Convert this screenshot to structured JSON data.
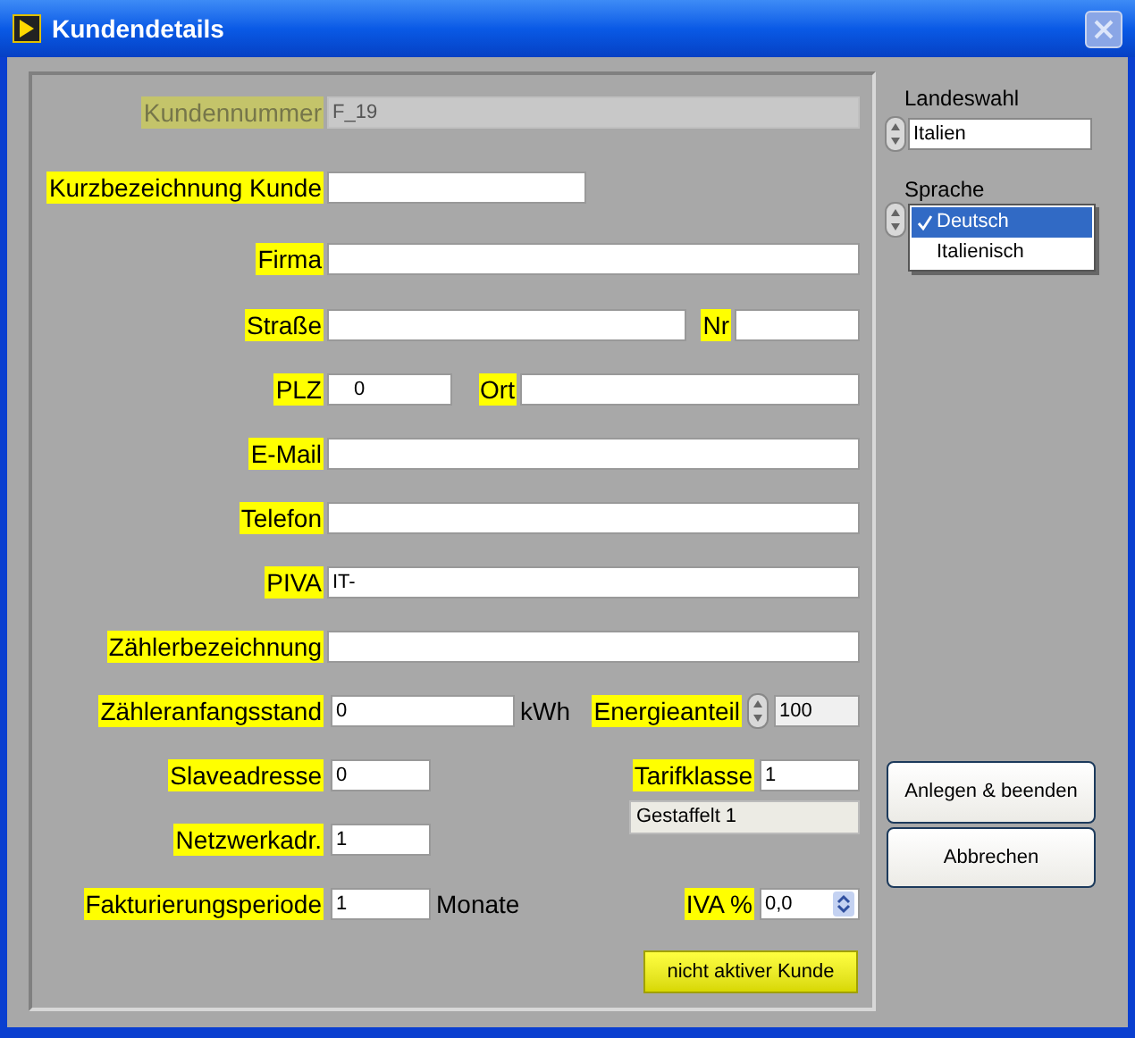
{
  "window": {
    "title": "Kundendetails"
  },
  "fields": [
    {
      "label": "Kundennummer",
      "value": "F_19",
      "kind": "text",
      "disabled": true
    },
    {
      "label": "Kurzbezeichnung Kunde",
      "kind": "text",
      "disabled": false
    },
    {
      "label": "Firma",
      "kind": "text",
      "disabled": false
    },
    {
      "label": "Straße",
      "kind": "text",
      "disabled": false
    },
    {
      "label": "Nr",
      "kind": "text",
      "disabled": false
    },
    {
      "label": "PLZ",
      "value": "0",
      "kind": "text",
      "disabled": false
    },
    {
      "label": "Ort",
      "kind": "text",
      "disabled": false
    },
    {
      "label": "E-Mail",
      "kind": "text",
      "disabled": false
    },
    {
      "label": "Telefon",
      "kind": "text",
      "disabled": false
    },
    {
      "label": "PIVA",
      "value": "IT-",
      "kind": "text",
      "disabled": false
    },
    {
      "label": "Zählerbezeichnung",
      "kind": "text",
      "disabled": false
    },
    {
      "label": "Zähleranfangsstand",
      "value": "0",
      "unit": "kWh",
      "kind": "text",
      "disabled": false
    },
    {
      "label": "Energieanteil",
      "value": "100",
      "kind": "spin",
      "disabled": false
    },
    {
      "label": "Slaveadresse",
      "value": "0",
      "kind": "text",
      "disabled": false
    },
    {
      "label": "Tarifklasse",
      "value": "1",
      "kind": "text",
      "disabled": false
    },
    {
      "label": "Netzwerkadr.",
      "value": "1",
      "kind": "text",
      "disabled": false
    },
    {
      "label": "Fakturierungsperiode",
      "value": "1",
      "unit": "Monate",
      "kind": "text",
      "disabled": false
    },
    {
      "label": "IVA %",
      "value": "0,0",
      "kind": "updown",
      "disabled": false
    }
  ],
  "tariff_display": "Gestaffelt 1",
  "status_button": "nicht aktiver Kunde",
  "country": {
    "label": "Landeswahl",
    "value": "Italien"
  },
  "language": {
    "label": "Sprache",
    "options": [
      {
        "label": "Deutsch",
        "selected": true
      },
      {
        "label": "Italienisch",
        "selected": false
      }
    ]
  },
  "buttons": [
    "Anlegen & beenden",
    "Abbrechen"
  ]
}
